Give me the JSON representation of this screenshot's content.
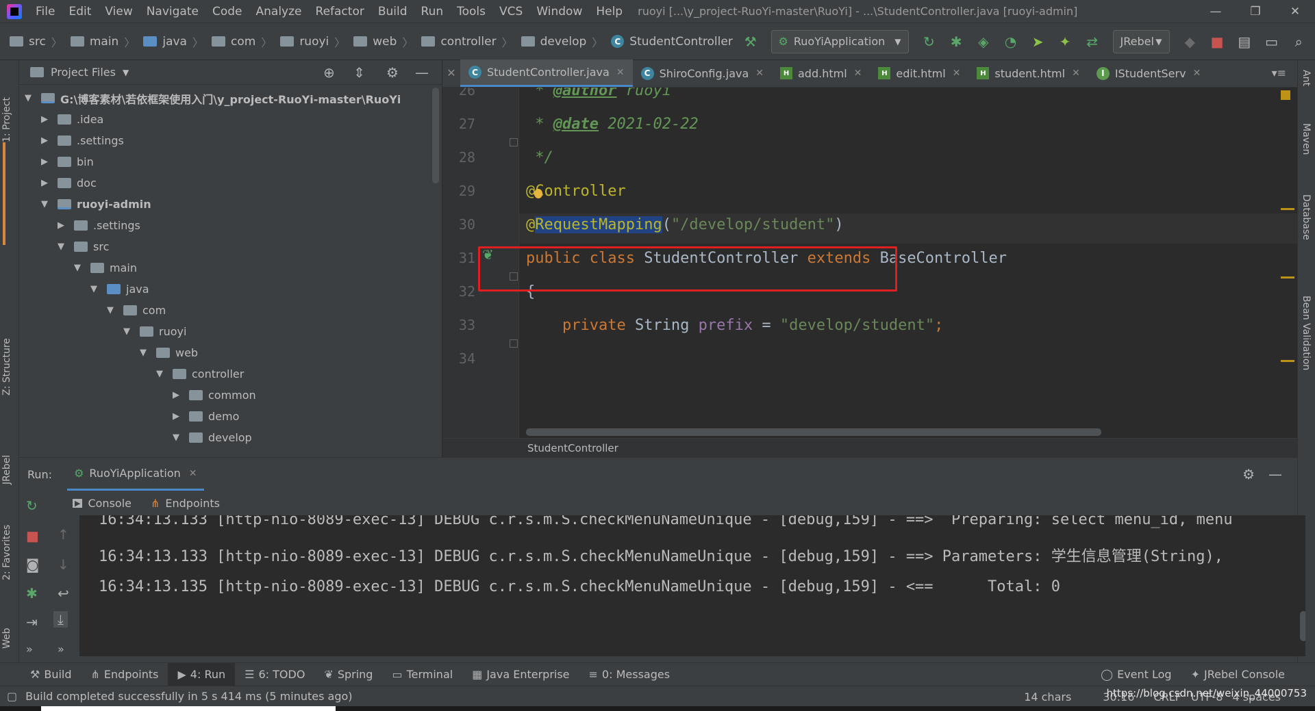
{
  "window": {
    "title": "ruoyi [...\\y_project-RuoYi-master\\RuoYi] - ...\\StudentController.java [ruoyi-admin]",
    "menu": [
      "File",
      "Edit",
      "View",
      "Navigate",
      "Code",
      "Analyze",
      "Refactor",
      "Build",
      "Run",
      "Tools",
      "VCS",
      "Window",
      "Help"
    ]
  },
  "navbar": {
    "breadcrumbs": [
      "src",
      "main",
      "java",
      "com",
      "ruoyi",
      "web",
      "controller",
      "develop",
      "StudentController"
    ],
    "run_config": "RuoYiApplication",
    "jrebel": "JRebel"
  },
  "left_strip": [
    "1: Project",
    "Z: Structure",
    "JRebel",
    "2: Favorites",
    "Web"
  ],
  "right_strip": [
    "Ant",
    "Maven",
    "Database",
    "Bean Validation"
  ],
  "project": {
    "header": "Project Files",
    "tree": [
      {
        "label": "G:\\博客素材\\若依框架使用入门\\y_project-RuoYi-master\\RuoYi",
        "depth": 0,
        "open": true,
        "bold": true,
        "type": "module"
      },
      {
        "label": ".idea",
        "depth": 1,
        "open": false,
        "type": "folder"
      },
      {
        "label": ".settings",
        "depth": 1,
        "open": false,
        "type": "folder"
      },
      {
        "label": "bin",
        "depth": 1,
        "open": false,
        "type": "folder"
      },
      {
        "label": "doc",
        "depth": 1,
        "open": false,
        "type": "folder"
      },
      {
        "label": "ruoyi-admin",
        "depth": 1,
        "open": true,
        "bold": true,
        "type": "module"
      },
      {
        "label": ".settings",
        "depth": 2,
        "open": false,
        "type": "folder"
      },
      {
        "label": "src",
        "depth": 2,
        "open": true,
        "type": "folder"
      },
      {
        "label": "main",
        "depth": 3,
        "open": true,
        "type": "folder"
      },
      {
        "label": "java",
        "depth": 4,
        "open": true,
        "type": "blue"
      },
      {
        "label": "com",
        "depth": 5,
        "open": true,
        "type": "folder"
      },
      {
        "label": "ruoyi",
        "depth": 6,
        "open": true,
        "type": "folder"
      },
      {
        "label": "web",
        "depth": 7,
        "open": true,
        "type": "folder"
      },
      {
        "label": "controller",
        "depth": 8,
        "open": true,
        "type": "folder"
      },
      {
        "label": "common",
        "depth": 9,
        "open": false,
        "type": "folder"
      },
      {
        "label": "demo",
        "depth": 9,
        "open": false,
        "type": "folder"
      },
      {
        "label": "develop",
        "depth": 9,
        "open": true,
        "type": "folder"
      }
    ]
  },
  "editor": {
    "tabs": [
      {
        "label": "StudentController.java",
        "kind": "class",
        "active": true
      },
      {
        "label": "ShiroConfig.java",
        "kind": "class",
        "active": false
      },
      {
        "label": "add.html",
        "kind": "html",
        "active": false
      },
      {
        "label": "edit.html",
        "kind": "html",
        "active": false
      },
      {
        "label": "student.html",
        "kind": "html",
        "active": false
      },
      {
        "label": "IStudentServ",
        "kind": "interface",
        "active": false
      }
    ],
    "lines": [
      {
        "n": "26",
        "tokens": [
          [
            "c-comment",
            " * "
          ],
          [
            "c-tag",
            "@author"
          ],
          [
            "c-comment",
            " ruoyi"
          ]
        ]
      },
      {
        "n": "27",
        "tokens": [
          [
            "c-comment",
            " * "
          ],
          [
            "c-tag",
            "@date"
          ],
          [
            "c-comment",
            " 2021-02-22"
          ]
        ]
      },
      {
        "n": "28",
        "tokens": [
          [
            "c-comment",
            " */"
          ]
        ]
      },
      {
        "n": "29",
        "tokens": [
          [
            "c-anno",
            "@Controller"
          ]
        ]
      },
      {
        "n": "30",
        "tokens": [
          [
            "c-anno",
            "@"
          ],
          [
            "c-anno sel",
            "RequestMapping"
          ],
          [
            "",
            "("
          ],
          [
            "c-str",
            "\"/develop/student\""
          ],
          [
            "",
            ")"
          ]
        ]
      },
      {
        "n": "31",
        "tokens": [
          [
            "c-kw",
            "public class "
          ],
          [
            "",
            "StudentController "
          ],
          [
            "c-kw",
            "extends "
          ],
          [
            "",
            "BaseController"
          ]
        ]
      },
      {
        "n": "32",
        "tokens": [
          [
            "",
            "{"
          ]
        ]
      },
      {
        "n": "33",
        "tokens": [
          [
            "",
            "    "
          ],
          [
            "c-kw",
            "private "
          ],
          [
            "",
            "String "
          ],
          [
            "c-field",
            "prefix"
          ],
          [
            "",
            " = "
          ],
          [
            "c-str",
            "\"develop/student\""
          ],
          [
            "c-kw",
            ";"
          ]
        ]
      },
      {
        "n": "34",
        "tokens": [
          [
            "",
            ""
          ]
        ]
      }
    ],
    "breadcrumb": "StudentController"
  },
  "run": {
    "label": "Run:",
    "tab": "RuoYiApplication",
    "console_tabs": [
      "Console",
      "Endpoints"
    ],
    "lines": [
      "16:34:13.133 [http-nio-8089-exec-13] DEBUG c.r.s.m.S.checkMenuNameUnique - [debug,159] - ==>  Preparing: select menu_id, menu",
      "16:34:13.133 [http-nio-8089-exec-13] DEBUG c.r.s.m.S.checkMenuNameUnique - [debug,159] - ==> Parameters: 学生信息管理(String),",
      "16:34:13.135 [http-nio-8089-exec-13] DEBUG c.r.s.m.S.checkMenuNameUnique - [debug,159] - <==      Total: 0"
    ]
  },
  "bottom_tools": [
    {
      "label": "Build",
      "icon": "hammer-icon"
    },
    {
      "label": "Endpoints",
      "icon": "endpoints-icon"
    },
    {
      "label": "4: Run",
      "icon": "run-icon",
      "active": true
    },
    {
      "label": "6: TODO",
      "icon": "todo-icon"
    },
    {
      "label": "Spring",
      "icon": "spring-icon"
    },
    {
      "label": "Terminal",
      "icon": "terminal-icon"
    },
    {
      "label": "Java Enterprise",
      "icon": "java-enterprise-icon"
    },
    {
      "label": "0: Messages",
      "icon": "messages-icon"
    }
  ],
  "bottom_tools_right": [
    {
      "label": "Event Log",
      "icon": "event-log-icon"
    },
    {
      "label": "JRebel Console",
      "icon": "jrebel-icon"
    }
  ],
  "status": {
    "message": "Build completed successfully in 5 s 414 ms (5 minutes ago)",
    "chars": "14 chars",
    "position": "30:16",
    "line_sep": "CRLF",
    "encoding": "UTF-8",
    "indent": "4 spaces",
    "watermark": "https://blog.csdn.net/weixin_44000753"
  },
  "colors": {
    "accent": "#4a88c7",
    "highlight_box": "#e02020",
    "selection": "#214283"
  }
}
